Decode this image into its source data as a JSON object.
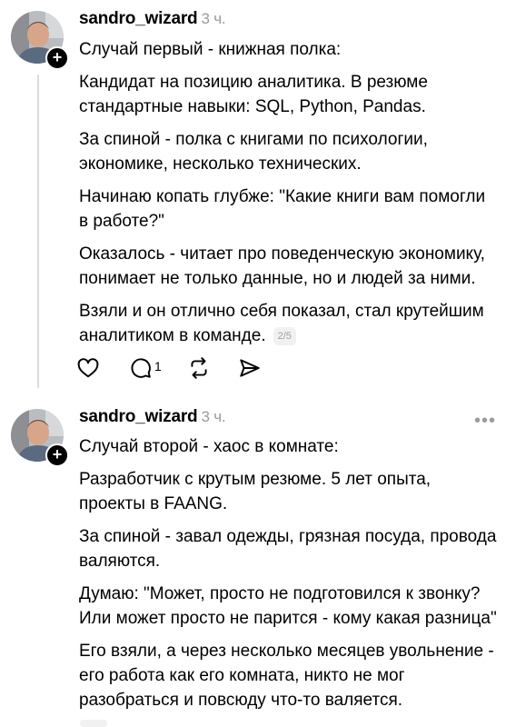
{
  "posts": [
    {
      "username": "sandro_wizard",
      "time": "3 ч.",
      "paragraphs": [
        "Случай первый - книжная полка:",
        "Кандидат на позицию аналитика. В резюме стандартные навыки: SQL, Python, Pandas.",
        "За спиной - полка с книгами по психологии, экономике, несколько технических.",
        "Начинаю копать глубже: \"Какие книги вам помогли в работе?\"",
        "Оказалось - читает про поведенческую экономику, понимает не только данные, но и людей за ними."
      ],
      "last_paragraph": "Взяли и он отлично себя показал, стал крутейшим аналитиком в команде.",
      "counter": "2/5",
      "reply_count": "1"
    },
    {
      "username": "sandro_wizard",
      "time": "3 ч.",
      "more": "•••",
      "paragraphs": [
        "Случай второй - хаос в комнате:",
        "Разработчик с крутым резюме. 5 лет опыта, проекты в FAANG.",
        "За спиной - завал одежды, грязная посуда, провода валяются.",
        "Думаю: \"Может, просто не подготовился к звонку? Или может просто не парится - кому какая разница\"",
        "Его взяли, а через несколько месяцев увольнение - его работа как его комната, никто не мог разобраться и повсюду что-то валяется."
      ]
    }
  ],
  "icons": [
    "heart-icon",
    "comment-icon",
    "repost-icon",
    "share-icon",
    "plus-icon",
    "more-icon"
  ]
}
